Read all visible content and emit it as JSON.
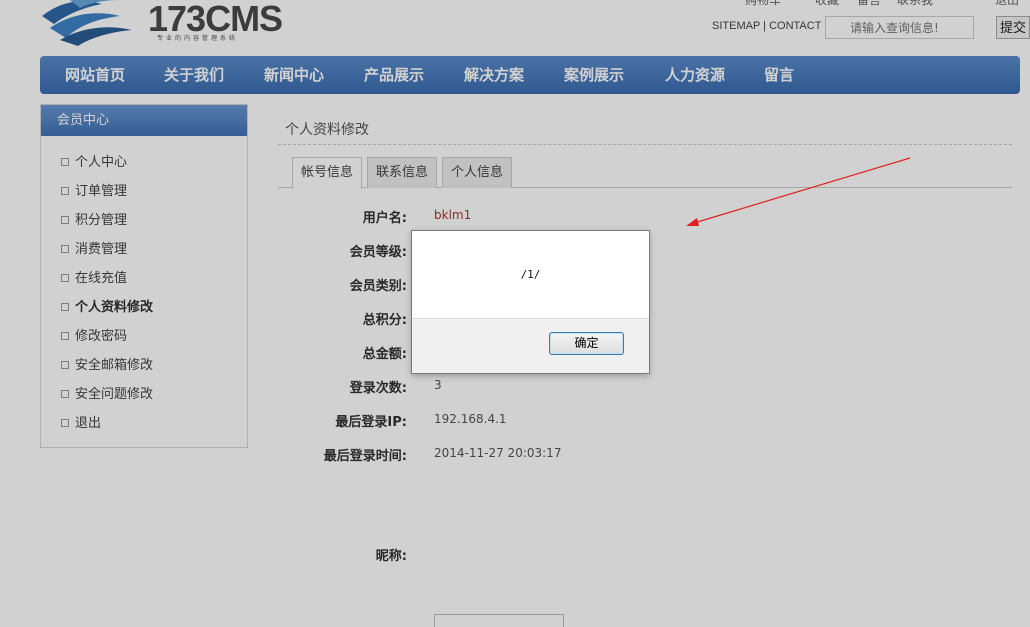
{
  "header": {
    "logo_text": "173CMS",
    "logo_slogan": "专业的内容管理系统",
    "top_cut_labels": [
      "购物车",
      "收藏",
      "留言",
      "联系我",
      "退出"
    ],
    "top_links": {
      "sitemap": "SITEMAP",
      "separator": "|",
      "contact": "CONTACT"
    },
    "search": {
      "placeholder": "请输入查询信息!",
      "button_label": "提交"
    }
  },
  "nav": {
    "items": [
      "网站首页",
      "关于我们",
      "新闻中心",
      "产品展示",
      "解决方案",
      "案例展示",
      "人力资源",
      "留言"
    ]
  },
  "sidebar": {
    "title": "会员中心",
    "items": [
      "个人中心",
      "订单管理",
      "积分管理",
      "消费管理",
      "在线充值",
      "个人资料修改",
      "修改密码",
      "安全邮箱修改",
      "安全问题修改",
      "退出"
    ],
    "active_index": 5
  },
  "main": {
    "title": "个人资料修改",
    "tabs": [
      "帐号信息",
      "联系信息",
      "个人信息"
    ],
    "active_tab": 0,
    "fields": {
      "username": {
        "label": "用户名:",
        "value": "bklm1"
      },
      "level": {
        "label": "会员等级:",
        "value": ""
      },
      "type": {
        "label": "会员类别:",
        "value": ""
      },
      "points": {
        "label": "总积分:",
        "value": ""
      },
      "balance": {
        "label": "总金额:",
        "value": ""
      },
      "login_count": {
        "label": "登录次数:",
        "value": "3"
      },
      "last_ip": {
        "label": "最后登录IP:",
        "value": "192.168.4.1"
      },
      "last_time": {
        "label": "最后登录时间:",
        "value": "2014-11-27 20:03:17"
      },
      "nickname": {
        "label": "昵称:",
        "value": ""
      }
    }
  },
  "dialog": {
    "message": "/1/",
    "ok_label": "确定"
  },
  "colors": {
    "nav_blue": "#3a6db0",
    "username_red": "#a23b2b",
    "arrow_red": "#e02020"
  }
}
